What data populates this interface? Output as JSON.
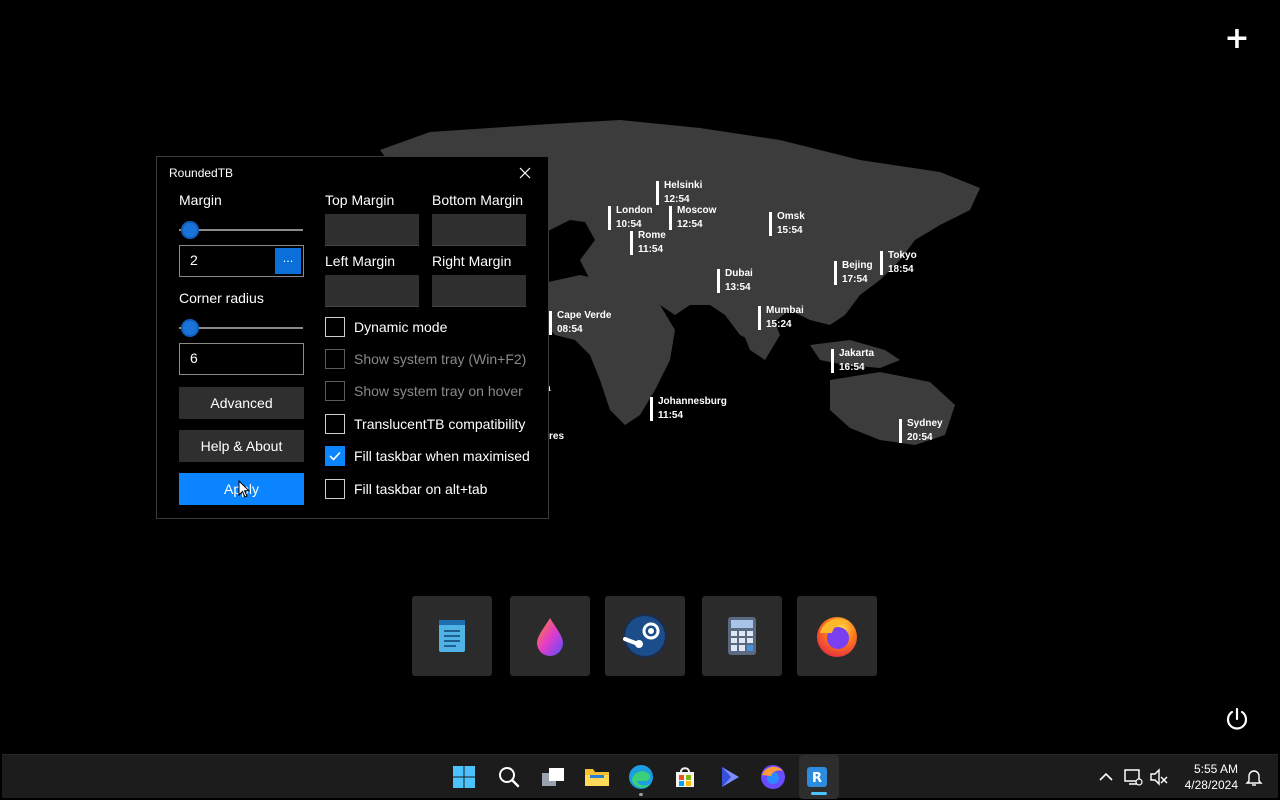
{
  "desktop": {
    "cities": [
      {
        "name": "Helsinki",
        "time": "12:54"
      },
      {
        "name": "London",
        "time": "10:54"
      },
      {
        "name": "Moscow",
        "time": "12:54"
      },
      {
        "name": "Omsk",
        "time": "15:54"
      },
      {
        "name": "Rome",
        "time": "11:54"
      },
      {
        "name": "Tokyo",
        "time": "18:54"
      },
      {
        "name": "Bejing",
        "time": "17:54"
      },
      {
        "name": "Dubai",
        "time": "13:54"
      },
      {
        "name": "Cape Verde",
        "time": "08:54"
      },
      {
        "name": "Mumbai",
        "time": "15:24"
      },
      {
        "name": "Jakarta",
        "time": "16:54"
      },
      {
        "name": "Johannesburg",
        "time": "11:54"
      },
      {
        "name": "Sydney",
        "time": "20:54"
      }
    ],
    "partial_labels": [
      "a",
      "res"
    ]
  },
  "dialog": {
    "title": "RoundedTB",
    "margin_label": "Margin",
    "margin_value": "2",
    "margin_slider_level": 0.02,
    "dots_label": "...",
    "corner_radius_label": "Corner radius",
    "corner_radius_value": "6",
    "corner_slider_level": 0.02,
    "advanced_label": "Advanced",
    "help_label": "Help & About",
    "apply_label": "Apply",
    "top_margin_label": "Top Margin",
    "bottom_margin_label": "Bottom Margin",
    "left_margin_label": "Left Margin",
    "right_margin_label": "Right Margin",
    "options": [
      {
        "label": "Dynamic mode",
        "checked": false,
        "enabled": true
      },
      {
        "label": "Show system tray (Win+F2)",
        "checked": false,
        "enabled": false
      },
      {
        "label": "Show system tray on hover",
        "checked": false,
        "enabled": false
      },
      {
        "label": "TranslucentTB compatibility",
        "checked": false,
        "enabled": true
      },
      {
        "label": "Fill taskbar when maximised",
        "checked": true,
        "enabled": true
      },
      {
        "label": "Fill taskbar on alt+tab",
        "checked": false,
        "enabled": true
      }
    ]
  },
  "dock": [
    "notepad-icon",
    "paint-drop-icon",
    "steam-icon",
    "calculator-icon",
    "firefox-icon"
  ],
  "taskbar": {
    "time": "5:55 AM",
    "date": "4/28/2024",
    "accent": "#4cc2ff"
  }
}
